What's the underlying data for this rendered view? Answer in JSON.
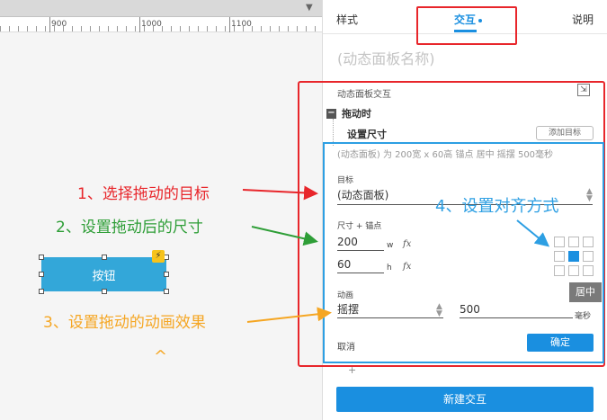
{
  "ruler": {
    "labels": [
      "900",
      "1000",
      "1100"
    ]
  },
  "canvas": {
    "widget_label": "按钮",
    "annotations": {
      "step1": "1、选择拖动的目标",
      "step2": "2、设置拖动后的尺寸",
      "step3": "3、设置拖动的动画效果",
      "step4": "4、设置对齐方式"
    },
    "caret": "^"
  },
  "panel": {
    "tabs": {
      "style": "样式",
      "interaction": "交互",
      "notes": "说明"
    },
    "name_placeholder": "(动态面板名称)",
    "section_title": "动态面板交互",
    "event_label": "拖动时",
    "event_toggle": "−",
    "action_title": "设置尺寸",
    "add_target": "添加目标",
    "summary": "(动态面板) 为 200宽 x 60高  锚点 居中 摇摆 500毫秒",
    "target": {
      "label": "目标",
      "value": "(动态面板)"
    },
    "size": {
      "label": "尺寸 + 锚点",
      "width": "200",
      "width_unit": "w",
      "height": "60",
      "height_unit": "h",
      "fx": "fx"
    },
    "anchor": {
      "selected_index": 4,
      "tooltip": "居中"
    },
    "animation": {
      "label": "动画",
      "easing": "摇摆",
      "duration": "500",
      "duration_unit": "毫秒"
    },
    "cancel": "取消",
    "ok": "确定",
    "plus": "+",
    "new_interaction": "新建交互"
  },
  "colors": {
    "accent_blue": "#1a8fe0",
    "widget_blue": "#33a7d9",
    "red": "#e8262b",
    "green": "#2e9e37",
    "orange": "#f5a623",
    "annotation_blue": "#2d9fe3"
  }
}
